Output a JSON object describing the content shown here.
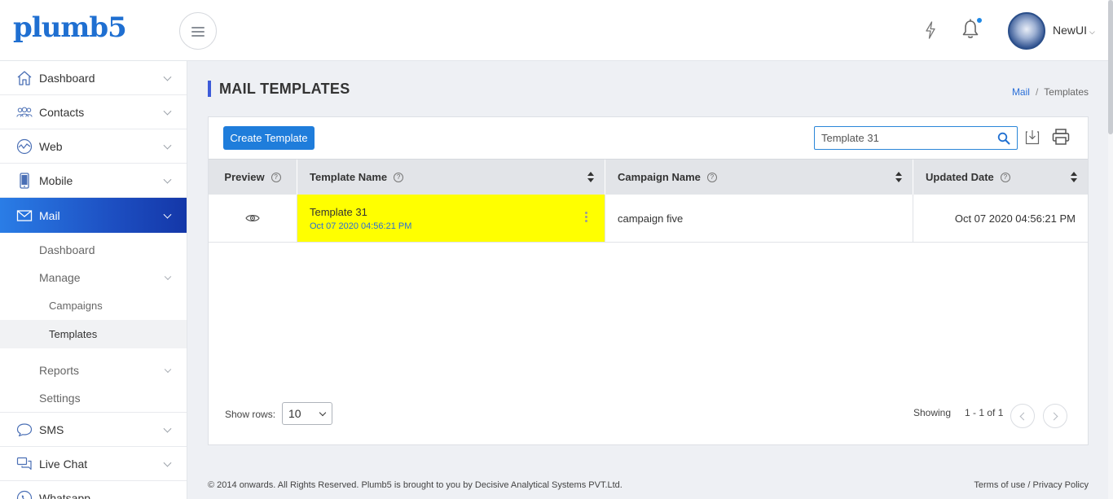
{
  "app": {
    "logo_text": "plumb5",
    "brand_color": "#1f6fd1",
    "accent_color": "#1d4fc2"
  },
  "header": {
    "username": "NewUI",
    "notification_badge": true
  },
  "sidebar": {
    "items": [
      {
        "label": "Dashboard",
        "icon": "home-icon"
      },
      {
        "label": "Contacts",
        "icon": "contacts-icon"
      },
      {
        "label": "Web",
        "icon": "web-icon"
      },
      {
        "label": "Mobile",
        "icon": "mobile-icon"
      },
      {
        "label": "Mail",
        "icon": "mail-icon",
        "active": true
      },
      {
        "label": "SMS",
        "icon": "sms-icon"
      },
      {
        "label": "Live Chat",
        "icon": "live-chat-icon"
      },
      {
        "label": "Whatsapp",
        "icon": "whatsapp-icon"
      }
    ],
    "mail_sub": {
      "dashboard": "Dashboard",
      "manage": "Manage",
      "campaigns": "Campaigns",
      "templates": "Templates",
      "reports": "Reports",
      "settings": "Settings"
    }
  },
  "page": {
    "title": "MAIL TEMPLATES",
    "breadcrumb": {
      "link": "Mail",
      "separator": "/",
      "current": "Templates"
    }
  },
  "toolbar": {
    "create_label": "Create Template",
    "search_value": "Template 31"
  },
  "table": {
    "columns": [
      "Preview",
      "Template Name",
      "Campaign Name",
      "Updated Date"
    ],
    "help_glyph": "?",
    "rows": [
      {
        "template_name": "Template 31",
        "template_date": "Oct 07 2020 04:56:21 PM",
        "campaign_name": "campaign five",
        "updated_date": "Oct 07 2020 04:56:21 PM",
        "highlight_color": "#ffff00"
      }
    ]
  },
  "pagination": {
    "show_rows_label": "Show rows:",
    "rows_value": "10",
    "showing_label": "Showing",
    "range": "1 - 1 of 1"
  },
  "footer": {
    "copyright": "© 2014 onwards. All Rights Reserved. Plumb5 is brought to you by Decisive Analytical Systems PVT.Ltd.",
    "terms": "Terms of use",
    "separator": "/",
    "privacy": "Privacy Policy"
  }
}
